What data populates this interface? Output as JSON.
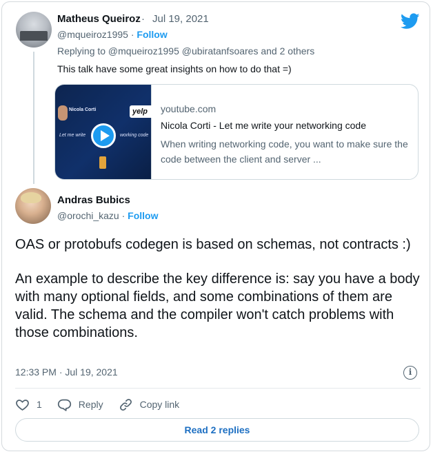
{
  "reply_tweet": {
    "author_name": "Matheus Queiroz",
    "separator": "·",
    "date": "Jul 19, 2021",
    "handle": "@mqueiroz1995",
    "handle_sep": "·",
    "follow_label": "Follow",
    "replying_to": "Replying to @mqueiroz1995 @ubiratanfsoares and 2 others",
    "text": "This talk have some great insights on how to do that =)"
  },
  "link_card": {
    "domain": "youtube.com",
    "title": "Nicola Corti - Let me write your networking code",
    "description": "When writing networking code, you want to make sure the code between the client and server ...",
    "thumbnail": {
      "speaker_name": "Nicola Corti",
      "brand": "yelp",
      "caption_left": "Let me write",
      "caption_right": "working code",
      "icon": "play-icon"
    }
  },
  "main_tweet": {
    "author_name": "Andras Bubics",
    "handle": "@orochi_kazu",
    "handle_sep": "·",
    "follow_label": "Follow",
    "paragraph_1": "OAS or protobufs codegen is based on schemas, not contracts :)",
    "paragraph_2": "An example to describe the key difference is: say you have a body with many optional fields, and some combinations of them are valid. The schema and the compiler won't catch problems with those combinations.",
    "timestamp": "12:33 PM · Jul 19, 2021",
    "info_icon": "i"
  },
  "actions": {
    "like_count": "1",
    "reply_label": "Reply",
    "copy_label": "Copy link"
  },
  "read_replies_label": "Read 2 replies",
  "colors": {
    "accent": "#1d9bf0",
    "secondary_text": "#536471",
    "primary_text": "#0f1419",
    "border": "#cfd9de"
  }
}
